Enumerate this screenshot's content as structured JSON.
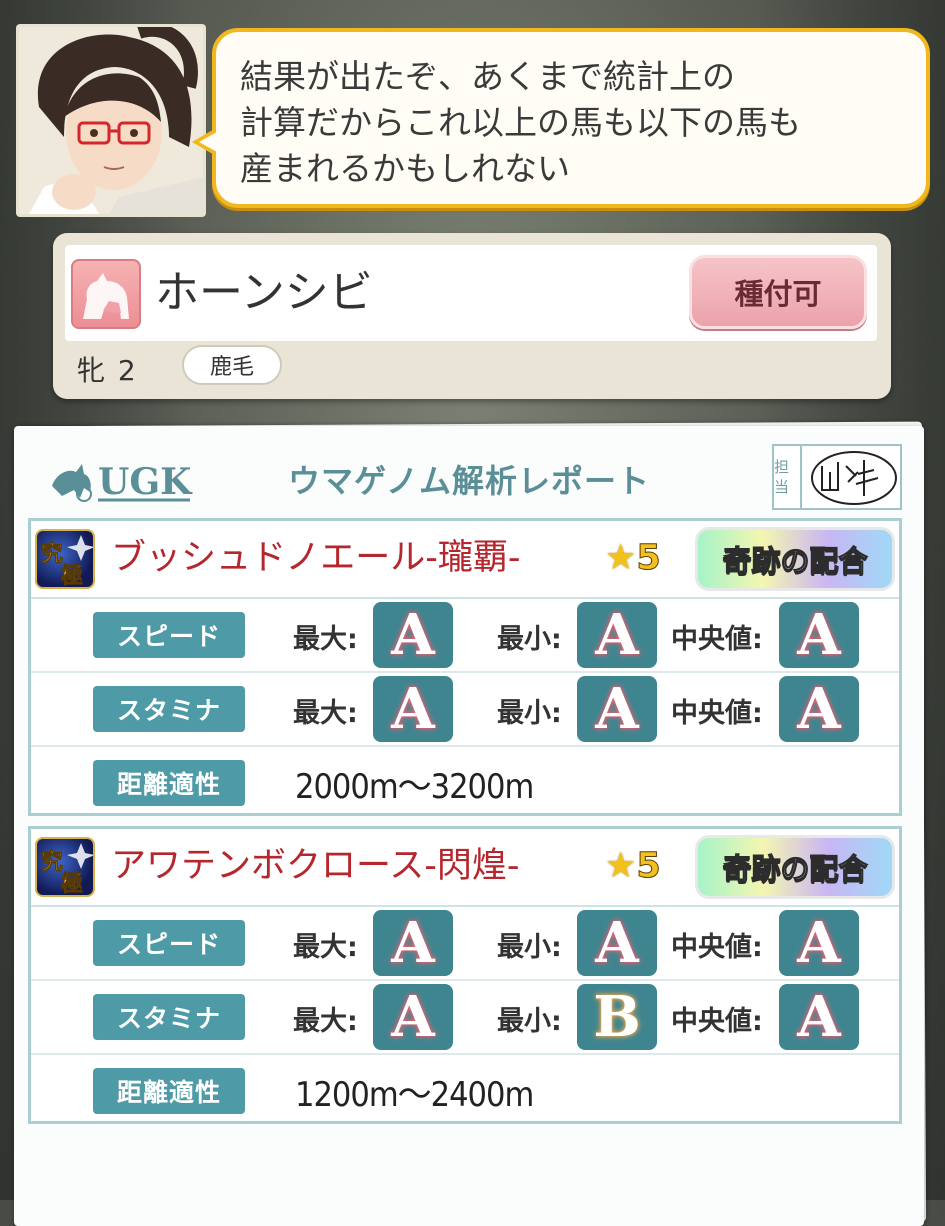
{
  "dialogue": {
    "text": "結果が出たぞ、あくまで統計上の\n計算だからこれ以上の馬も以下の馬も\n産まれるかもしれない"
  },
  "horse": {
    "name": "ホーンシビ",
    "breed_button": "種付可",
    "sex_age": "牝 2",
    "coat": "鹿毛"
  },
  "report": {
    "logo": "UGK",
    "title": "ウマゲノム解析レポート",
    "stamp_label": "担当",
    "results": [
      {
        "name": "ブッシュドノエール-瓏覇-",
        "star_prefix": "★",
        "stars": "5",
        "badge": "奇跡の配合",
        "speed_label": "スピード",
        "stamina_label": "スタミナ",
        "distance_label": "距離適性",
        "max_label": "最大:",
        "min_label": "最小:",
        "median_label": "中央値:",
        "speed": {
          "max": "A",
          "min": "A",
          "median": "A"
        },
        "stamina": {
          "max": "A",
          "min": "A",
          "median": "A"
        },
        "distance": "2000m〜3200m"
      },
      {
        "name": "アワテンボクロース-閃煌-",
        "star_prefix": "★",
        "stars": "5",
        "badge": "奇跡の配合",
        "speed_label": "スピード",
        "stamina_label": "スタミナ",
        "distance_label": "距離適性",
        "max_label": "最大:",
        "min_label": "最小:",
        "median_label": "中央値:",
        "speed": {
          "max": "A",
          "min": "A",
          "median": "A"
        },
        "stamina": {
          "max": "A",
          "min": "B",
          "median": "A"
        },
        "distance": "1200m〜2400m"
      }
    ]
  },
  "colors": {
    "bubble_border": "#f0b81e",
    "report_accent": "#4e9aa6",
    "horse_name_red": "#b5262d",
    "breed_button": "#eca2ab"
  }
}
